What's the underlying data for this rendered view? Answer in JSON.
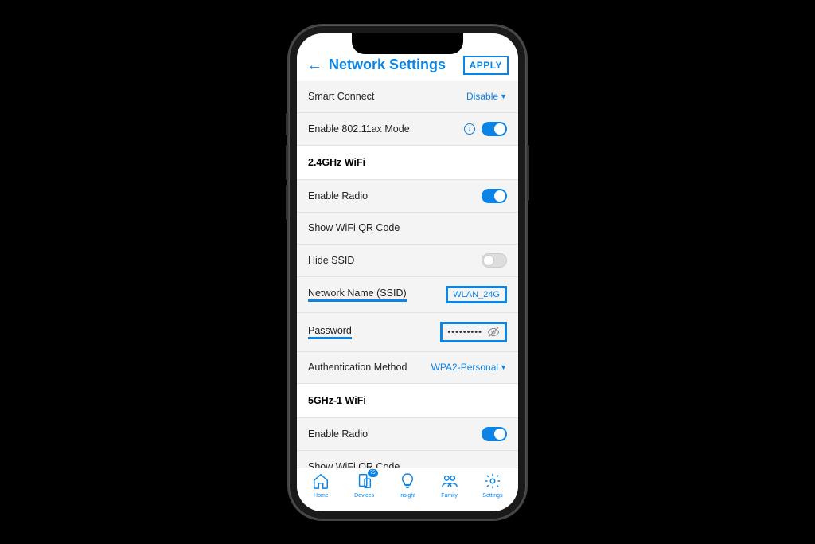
{
  "header": {
    "title": "Network Settings",
    "apply": "APPLY"
  },
  "rows": {
    "smart_connect": {
      "label": "Smart Connect",
      "value": "Disable"
    },
    "ax_mode": {
      "label": "Enable 802.11ax Mode"
    },
    "band24_head": "2.4GHz WiFi",
    "enable_radio": "Enable Radio",
    "show_qr": "Show WiFi QR Code",
    "hide_ssid": "Hide SSID",
    "ssid": {
      "label": "Network Name (SSID)",
      "value": "WLAN_24G"
    },
    "password": {
      "label": "Password",
      "value": "•••••••••"
    },
    "auth": {
      "label": "Authentication Method",
      "value": "WPA2-Personal"
    },
    "band5_head": "5GHz-1 WiFi"
  },
  "tabs": {
    "home": "Home",
    "devices": "Devices",
    "devices_badge": "75",
    "insight": "Insight",
    "family": "Family",
    "settings": "Settings"
  }
}
